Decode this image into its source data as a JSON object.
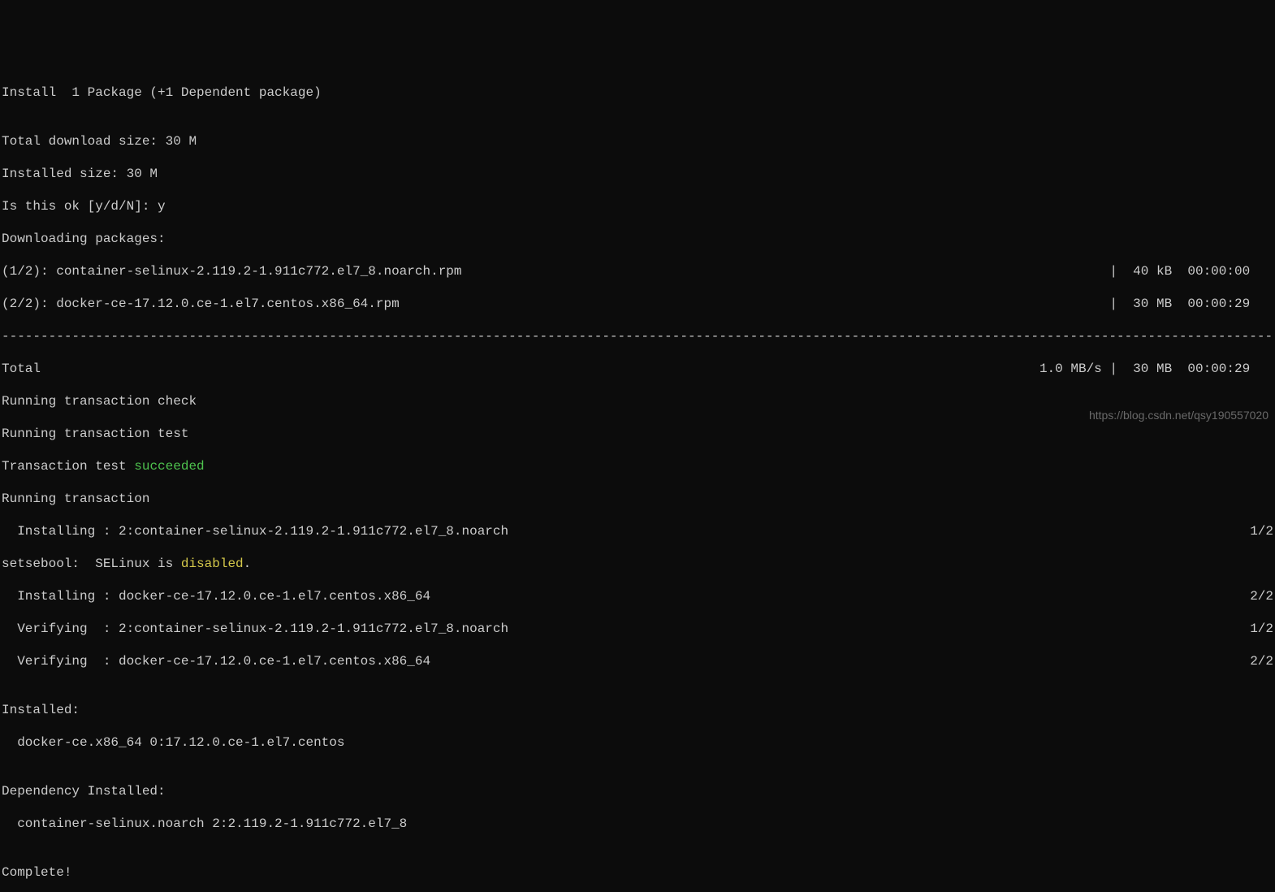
{
  "install_header": "Install  1 Package (+1 Dependent package)",
  "blank": "",
  "total_download": "Total download size: 30 M",
  "installed_size": "Installed size: 30 M",
  "confirm": "Is this ok [y/d/N]: y",
  "downloading": "Downloading packages:",
  "pkg1": {
    "left": "(1/2): container-selinux-2.119.2-1.911c772.el7_8.noarch.rpm",
    "right": "|  40 kB  00:00:00   "
  },
  "pkg2": {
    "left": "(2/2): docker-ce-17.12.0.ce-1.el7.centos.x86_64.rpm",
    "right": "|  30 MB  00:00:29   "
  },
  "dashes": "-------------------------------------------------------------------------------------------------------------------------------------------------------------------------------",
  "total_line": {
    "left": "Total",
    "right": "1.0 MB/s |  30 MB  00:00:29   "
  },
  "run_check": "Running transaction check",
  "run_test": "Running transaction test",
  "tx_test": {
    "prefix": "Transaction test ",
    "status": "succeeded"
  },
  "run_tx": "Running transaction",
  "install1": {
    "left": "  Installing : 2:container-selinux-2.119.2-1.911c772.el7_8.noarch",
    "right": "1/2"
  },
  "selinux": {
    "prefix": "setsebool:  SELinux is ",
    "status": "disabled",
    "suffix": "."
  },
  "install2": {
    "left": "  Installing : docker-ce-17.12.0.ce-1.el7.centos.x86_64",
    "right": "2/2"
  },
  "verify1": {
    "left": "  Verifying  : 2:container-selinux-2.119.2-1.911c772.el7_8.noarch",
    "right": "1/2"
  },
  "verify2": {
    "left": "  Verifying  : docker-ce-17.12.0.ce-1.el7.centos.x86_64",
    "right": "2/2"
  },
  "installed_hdr": "Installed:",
  "installed_pkg": "  docker-ce.x86_64 0:17.12.0.ce-1.el7.centos",
  "dep_hdr": "Dependency Installed:",
  "dep_pkg": "  container-selinux.noarch 2:2.119.2-1.911c772.el7_8",
  "complete": "Complete!",
  "watermark": "https://blog.csdn.net/qsy190557020"
}
